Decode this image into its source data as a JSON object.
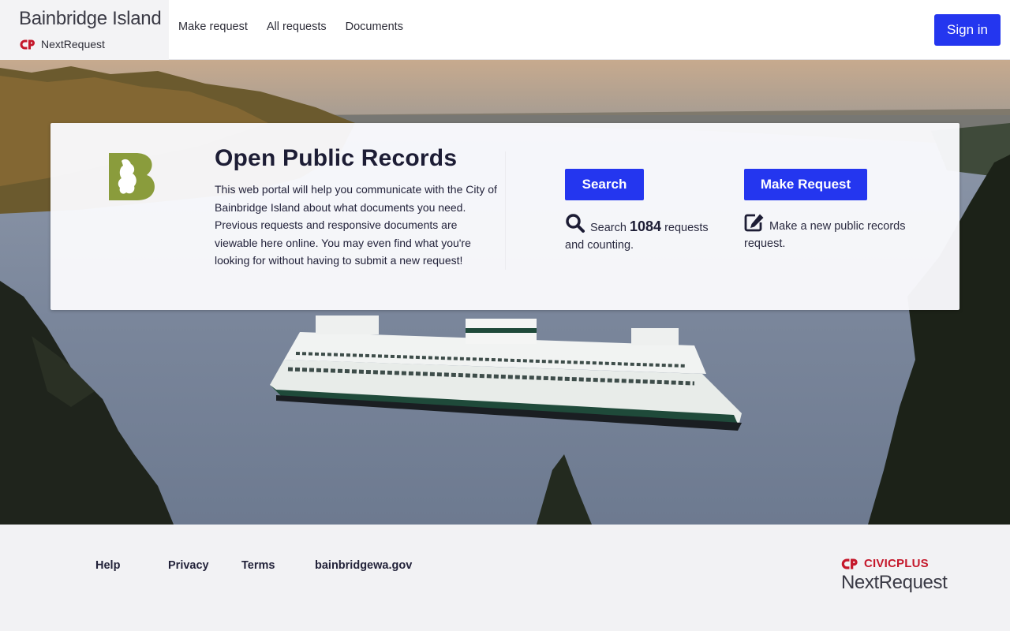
{
  "header": {
    "site_title": "Bainbridge Island",
    "product_name": "NextRequest",
    "nav": [
      {
        "label": "Make request"
      },
      {
        "label": "All requests"
      },
      {
        "label": "Documents"
      }
    ],
    "sign_in_label": "Sign in"
  },
  "card": {
    "title": "Open Public Records",
    "description": "This web portal will help you communicate with the City of Bainbridge Island about what documents you need. Previous requests and responsive documents are viewable here online. You may even find what you're looking for without having to submit a new request!",
    "search_button": "Search",
    "search_stat_prefix": "Search",
    "search_count": "1084",
    "search_stat_suffix": "requests and counting.",
    "make_button": "Make Request",
    "make_stat": "Make a new public records request."
  },
  "footer": {
    "links": [
      {
        "label": "Help"
      },
      {
        "label": "Privacy"
      },
      {
        "label": "Terms"
      },
      {
        "label": "bainbridgewa.gov"
      }
    ],
    "vendor_name": "CIVICPLUS",
    "vendor_product": "NextRequest"
  },
  "colors": {
    "primary": "#2436ef",
    "civicplus_red": "#c5182b",
    "logo_green": "#8a9c3c"
  },
  "icons": {
    "search": "search-icon",
    "edit": "edit-icon",
    "brand": "civicplus-logo-icon",
    "city": "bainbridge-b-logo"
  }
}
